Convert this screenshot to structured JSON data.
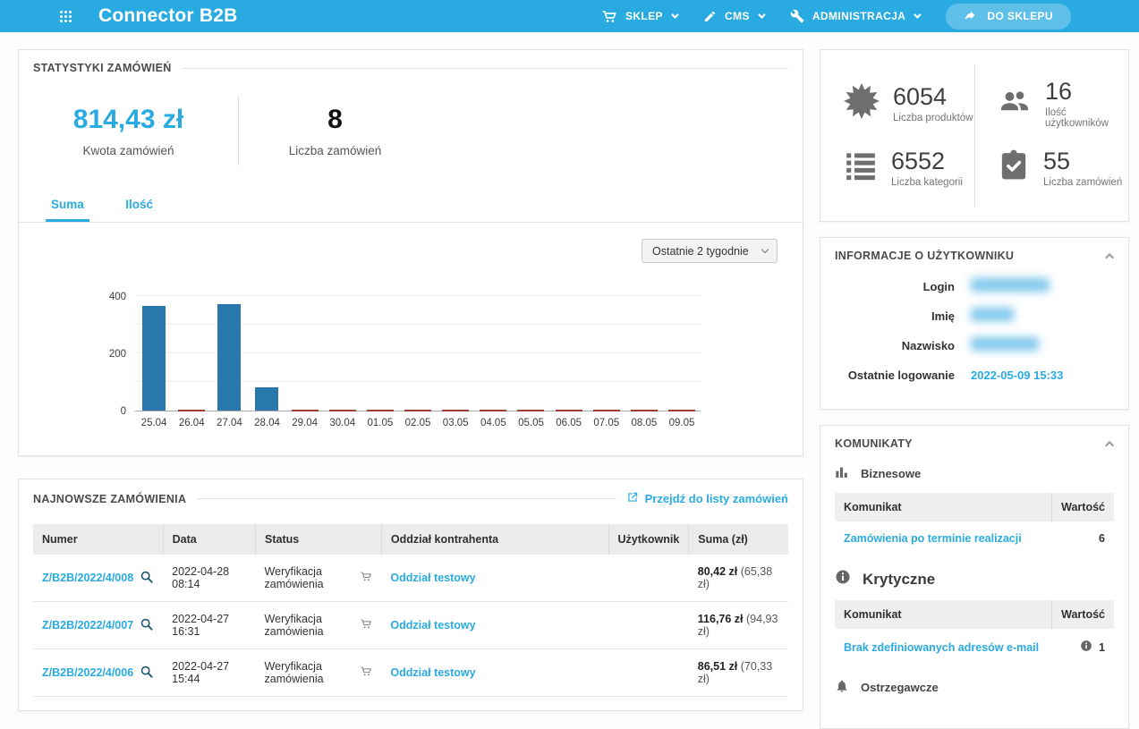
{
  "navbar": {
    "brand": "Connector B2B",
    "menu": [
      {
        "label": "SKLEP",
        "icon": "cart-icon"
      },
      {
        "label": "CMS",
        "icon": "pencil-icon"
      },
      {
        "label": "ADMINISTRACJA",
        "icon": "wrench-icon"
      }
    ],
    "cta": "DO SKLEPU"
  },
  "colors": {
    "accent": "#29abe2",
    "bar": "#2878ae",
    "zero_marker": "#9c3c36",
    "icon_gray": "#6e6e6e"
  },
  "stats_panel": {
    "title": "STATYSTYKI ZAMÓWIEŃ",
    "kpis": [
      {
        "value": "814,43 zł",
        "label": "Kwota zamówień"
      },
      {
        "value": "8",
        "label": "Liczba zamówień"
      }
    ],
    "tabs": [
      {
        "label": "Suma",
        "active": true
      },
      {
        "label": "Ilość",
        "active": false
      }
    ],
    "range_select": "Ostatnie 2 tygodnie"
  },
  "chart_data": {
    "type": "bar",
    "title": "",
    "xlabel": "",
    "ylabel": "",
    "categories": [
      "25.04",
      "26.04",
      "27.04",
      "28.04",
      "29.04",
      "30.04",
      "01.05",
      "02.05",
      "03.05",
      "04.05",
      "05.05",
      "06.05",
      "07.05",
      "08.05",
      "09.05"
    ],
    "values": [
      365,
      0,
      371,
      80,
      0,
      0,
      0,
      0,
      0,
      0,
      0,
      0,
      0,
      0,
      0
    ],
    "ylim": [
      0,
      400
    ],
    "yticks": [
      0,
      200,
      400
    ],
    "gridlines": [
      100,
      200,
      300,
      400
    ],
    "grid": true,
    "legend": false,
    "bar_color": "#2878ae",
    "zero_marker_color": "#9c3c36"
  },
  "orders_panel": {
    "title": "NAJNOWSZE ZAMÓWIENIA",
    "link": "Przejdź do listy zamówień",
    "columns": [
      "Numer",
      "Data",
      "Status",
      "Oddział kontrahenta",
      "Użytkownik",
      "Suma (zł)"
    ],
    "rows": [
      {
        "numer": "Z/B2B/2022/4/008",
        "data": "2022-04-28 08:14",
        "status": "Weryfikacja zamówienia",
        "oddzial": "Oddział testowy",
        "suma": "80,42 zł",
        "suma_alt": "(65,38 zł)"
      },
      {
        "numer": "Z/B2B/2022/4/007",
        "data": "2022-04-27 16:31",
        "status": "Weryfikacja zamówienia",
        "oddzial": "Oddział testowy",
        "suma": "116,76 zł",
        "suma_alt": "(94,93 zł)"
      },
      {
        "numer": "Z/B2B/2022/4/006",
        "data": "2022-04-27 15:44",
        "status": "Weryfikacja zamówienia",
        "oddzial": "Oddział testowy",
        "suma": "86,51 zł",
        "suma_alt": "(70,33 zł)"
      }
    ]
  },
  "summary_cards": [
    {
      "value": "6054",
      "label": "Liczba produktów",
      "icon": "burst-icon"
    },
    {
      "value": "16",
      "label": "Ilość użytkowników",
      "icon": "users-icon"
    },
    {
      "value": "6552",
      "label": "Liczba kategorii",
      "icon": "list-icon"
    },
    {
      "value": "55",
      "label": "Liczba zamówień",
      "icon": "clipboard-check-icon"
    }
  ],
  "user_panel": {
    "title": "INFORMACJE O UŻYTKOWNIKU",
    "fields": [
      {
        "label": "Login",
        "value": "",
        "redacted": true
      },
      {
        "label": "Imię",
        "value": "",
        "redacted": true
      },
      {
        "label": "Nazwisko",
        "value": "",
        "redacted": true
      },
      {
        "label": "Ostatnie logowanie",
        "value": "2022-05-09 15:33",
        "redacted": false
      }
    ]
  },
  "messages_panel": {
    "title": "KOMUNIKATY",
    "col_komunikat": "Komunikat",
    "col_wartosc": "Wartość",
    "biznesowe": {
      "heading": "Biznesowe",
      "row_label": "Zamówienia po terminie realizacji",
      "row_value": "6"
    },
    "krytyczne": {
      "heading": "Krytyczne",
      "row_label": "Brak zdefiniowanych adresów e-mail",
      "row_value": "1"
    },
    "ostrzegawcze": {
      "heading": "Ostrzegawcze"
    }
  }
}
